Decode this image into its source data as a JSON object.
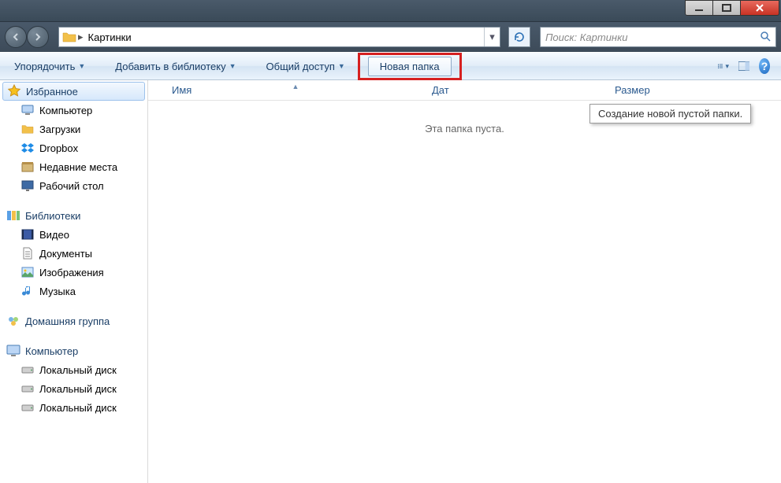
{
  "address": {
    "crumb": "Картинки"
  },
  "search": {
    "placeholder": "Поиск: Картинки"
  },
  "toolbar": {
    "organize": "Упорядочить",
    "addToLibrary": "Добавить в библиотеку",
    "share": "Общий доступ",
    "newFolder": "Новая папка"
  },
  "tooltip": "Создание новой пустой папки.",
  "columns": {
    "name": "Имя",
    "date": "Дат",
    "size": "Размер"
  },
  "emptyMsg": "Эта папка пуста.",
  "sidebar": {
    "favorites": {
      "label": "Избранное",
      "items": [
        "Компьютер",
        "Загрузки",
        "Dropbox",
        "Недавние места",
        "Рабочий стол"
      ]
    },
    "libraries": {
      "label": "Библиотеки",
      "items": [
        "Видео",
        "Документы",
        "Изображения",
        "Музыка"
      ]
    },
    "homegroup": {
      "label": "Домашняя группа"
    },
    "computer": {
      "label": "Компьютер",
      "items": [
        "Локальный диск",
        "Локальный диск",
        "Локальный диск"
      ]
    }
  }
}
